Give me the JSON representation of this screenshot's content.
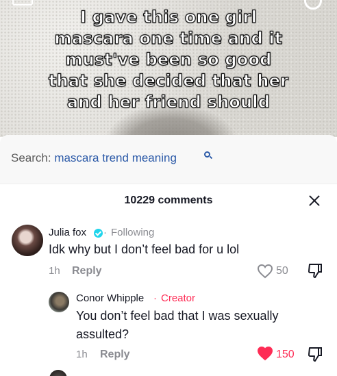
{
  "video": {
    "overlay_lines": [
      "I gave this one girl",
      "mascara one time and it",
      "must've been so good",
      "that she decided that her",
      "and her friend should"
    ]
  },
  "search": {
    "label": "Search: ",
    "query": "mascara trend meaning",
    "icon": "search-icon"
  },
  "comments_header": {
    "count_text": "10229 comments",
    "close_icon": "close-icon"
  },
  "comments": [
    {
      "username": "Julia fox",
      "verified": true,
      "separator": "·",
      "relation": "Following",
      "text": "Idk why but I don’t feel bad for u lol",
      "time": "1h",
      "reply_label": "Reply",
      "likes": "50",
      "liked": false
    },
    {
      "username": "Conor Whipple",
      "separator": "·",
      "relation": "Creator",
      "text_lines": [
        "You don’t feel bad that I was sexually",
        "assulted?"
      ],
      "time": "1h",
      "reply_label": "Reply",
      "likes": "150",
      "liked": true
    }
  ],
  "colors": {
    "accent_red": "#fe2c55",
    "search_blue": "#2c5aa8",
    "verified_cyan": "#20d5ec",
    "text_primary": "#161823",
    "text_secondary": "#8a8b91"
  }
}
